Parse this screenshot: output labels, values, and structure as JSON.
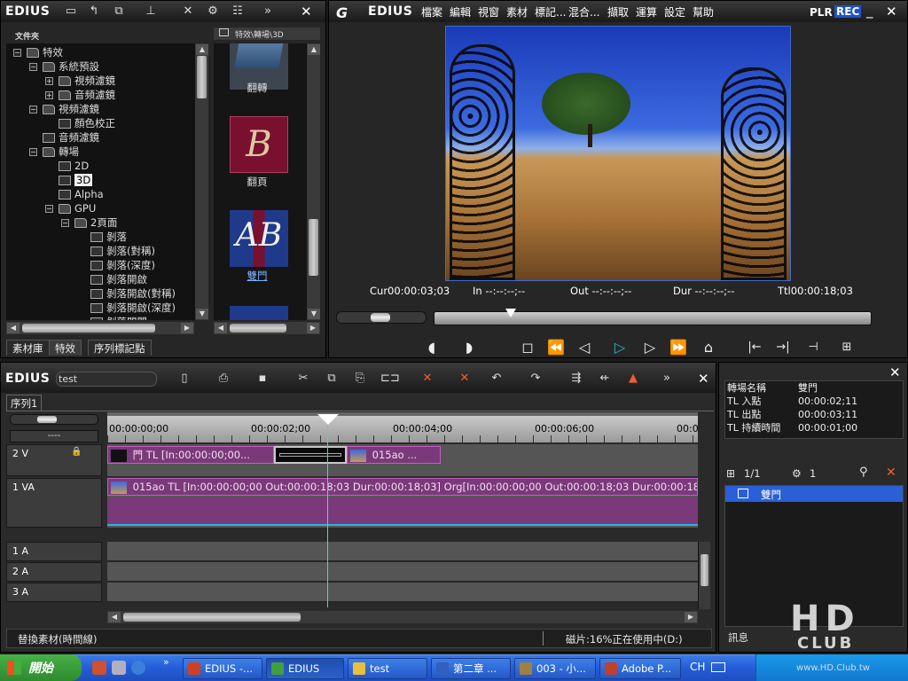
{
  "bin_window": {
    "logo": "EDIUS",
    "folder_header": "文件夾",
    "path_header": "特效\\轉場\\3D",
    "tree": [
      {
        "label": "特效",
        "exp": "−",
        "depth": 0
      },
      {
        "label": "系統預設",
        "exp": "−",
        "depth": 1
      },
      {
        "label": "視頻濾鏡",
        "exp": "+",
        "depth": 2
      },
      {
        "label": "音頻濾鏡",
        "exp": "+",
        "depth": 2
      },
      {
        "label": "視頻濾鏡",
        "exp": "−",
        "depth": 1
      },
      {
        "label": "顏色校正",
        "exp": "",
        "depth": 2
      },
      {
        "label": "音頻濾鏡",
        "exp": "",
        "depth": 1
      },
      {
        "label": "轉場",
        "exp": "−",
        "depth": 1
      },
      {
        "label": "2D",
        "exp": "",
        "depth": 2
      },
      {
        "label": "3D",
        "exp": "",
        "depth": 2,
        "selected": true
      },
      {
        "label": "Alpha",
        "exp": "",
        "depth": 2
      },
      {
        "label": "GPU",
        "exp": "−",
        "depth": 2
      },
      {
        "label": "2頁面",
        "exp": "−",
        "depth": 3
      },
      {
        "label": "剝落",
        "exp": "",
        "depth": 4
      },
      {
        "label": "剝落(對稱)",
        "exp": "",
        "depth": 4
      },
      {
        "label": "剝落(深度)",
        "exp": "",
        "depth": 4
      },
      {
        "label": "剝落開啟",
        "exp": "",
        "depth": 4
      },
      {
        "label": "剝落開啟(對稱)",
        "exp": "",
        "depth": 4
      },
      {
        "label": "剝落開啟(深度)",
        "exp": "",
        "depth": 4
      },
      {
        "label": "剝落開門",
        "exp": "",
        "depth": 4
      }
    ],
    "thumbs": [
      {
        "label": "翻轉"
      },
      {
        "label": "翻頁"
      },
      {
        "label": "雙門",
        "selected": true
      }
    ],
    "tabs": [
      "素材庫",
      "特效",
      "序列標記點"
    ]
  },
  "player": {
    "logo": "EDIUS",
    "menu": [
      "檔案",
      "編輯",
      "視窗",
      "素材",
      "標記...",
      "混合...",
      "擷取",
      "運算",
      "設定",
      "幫助"
    ],
    "mode_plr": "PLR",
    "mode_rec": "REC",
    "timecodes": {
      "cur_label": "Cur",
      "cur": "00:00:03;03",
      "in_label": "In",
      "in": "--:--:--;--",
      "out_label": "Out",
      "out": "--:--:--;--",
      "dur_label": "Dur",
      "dur": "--:--:--;--",
      "ttl_label": "Ttl",
      "ttl": "00:00:18;03"
    }
  },
  "timeline": {
    "logo": "EDIUS",
    "project_name": "test",
    "sequence_tab": "序列1",
    "ruler_marks": [
      "00:00:00;00",
      "00:00:02;00",
      "00:00:04;00",
      "00:00:06;00",
      "00:00"
    ],
    "view_dropdown": "----",
    "tracks": [
      {
        "name": "2 V"
      },
      {
        "name": "1 VA"
      },
      {
        "name": "1 A"
      },
      {
        "name": "2 A"
      },
      {
        "name": "3 A"
      }
    ],
    "clip_2v_a": "門  TL [In:00:00:00;00...",
    "clip_2v_b": "015ao ...",
    "clip_1va": "015ao  TL [In:00:00:00;00 Out:00:00:18;03 Dur:00:00:18;03]  Org[In:00:00:00;00 Out:00:00:18;03 Dur:00:00:18;03]",
    "status_left": "替換素材(時間線)",
    "status_right": "磁片:16%正在使用中(D:)"
  },
  "info_panel": {
    "rows": [
      {
        "k": "轉場名稱",
        "v": "雙門"
      },
      {
        "k": "TL 入點",
        "v": "00:00:02;11"
      },
      {
        "k": "TL 出點",
        "v": "00:00:03;11"
      },
      {
        "k": "TL 持續時間",
        "v": "00:00:01;00"
      }
    ],
    "page": "1/1",
    "count": "1",
    "effect_item": "雙門",
    "footer": "訊息"
  },
  "taskbar": {
    "start": "開始",
    "buttons": [
      {
        "label": "EDIUS -...",
        "color": "#d04020"
      },
      {
        "label": "EDIUS",
        "color": "#40a040",
        "active": true
      },
      {
        "label": "test",
        "color": "#e8c040"
      },
      {
        "label": "第二章 ...",
        "color": "#3060c0"
      },
      {
        "label": "003 - 小...",
        "color": "#a08040"
      },
      {
        "label": "Adobe P...",
        "color": "#c04030"
      }
    ],
    "lang": "CH",
    "watermark_big": "HD",
    "watermark_small": "CLUB",
    "watermark_url": "www.HD.Club.tw"
  }
}
